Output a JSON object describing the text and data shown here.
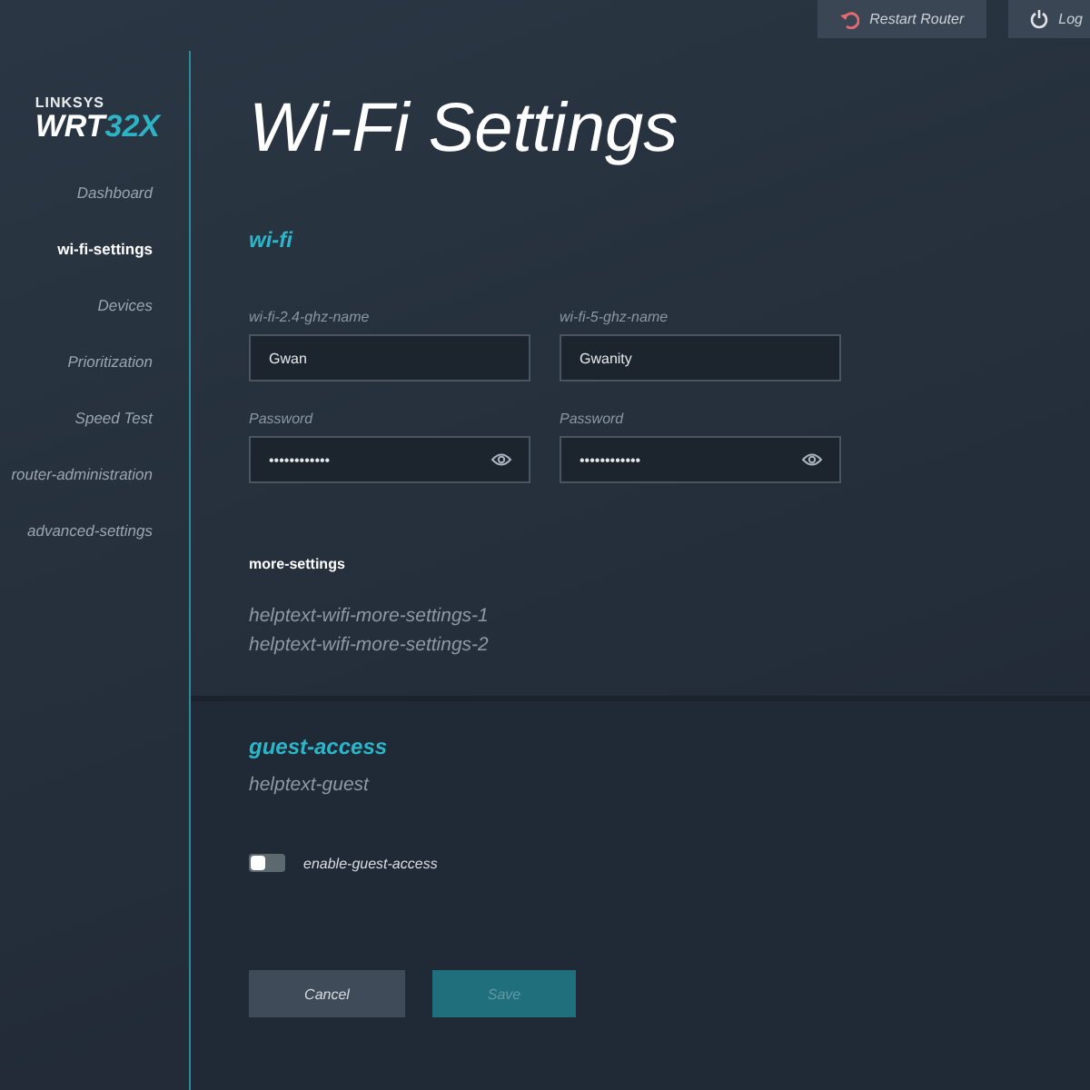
{
  "top_actions": [
    {
      "kind": "restart",
      "label": "Restart Router"
    },
    {
      "kind": "logout",
      "label": "Log"
    }
  ],
  "logo": {
    "brand": "LINKSYS",
    "model": "WRT",
    "model_suffix": "32X"
  },
  "sidebar": {
    "items": [
      {
        "label": "Dashboard",
        "selected": false
      },
      {
        "label": "wi-fi-settings",
        "selected": true
      },
      {
        "label": "Devices",
        "selected": false
      },
      {
        "label": "Prioritization",
        "selected": false
      },
      {
        "label": "Speed Test",
        "selected": false
      },
      {
        "label": "router-administration",
        "selected": false
      },
      {
        "label": "advanced-settings",
        "selected": false
      }
    ]
  },
  "page_title": "Wi-Fi Settings",
  "wifi": {
    "heading": "wi-fi",
    "bands": [
      {
        "name_label": "wi-fi-2.4-ghz-name",
        "name_value": "Gwan",
        "password_label": "Password",
        "password_value": "••••••••••••"
      },
      {
        "name_label": "wi-fi-5-ghz-name",
        "name_value": "Gwanity",
        "password_label": "Password",
        "password_value": "••••••••••••"
      }
    ],
    "more_settings": {
      "heading": "more-settings",
      "help": [
        "helptext-wifi-more-settings-1",
        "helptext-wifi-more-settings-2"
      ]
    }
  },
  "guest": {
    "heading": "guest-access",
    "help": "helptext-guest",
    "toggle": {
      "label": "enable-guest-access",
      "on": false
    }
  },
  "buttons": [
    {
      "kind": "secondary",
      "label": "Cancel",
      "disabled": false
    },
    {
      "kind": "primary",
      "label": "Save",
      "disabled": true
    }
  ]
}
